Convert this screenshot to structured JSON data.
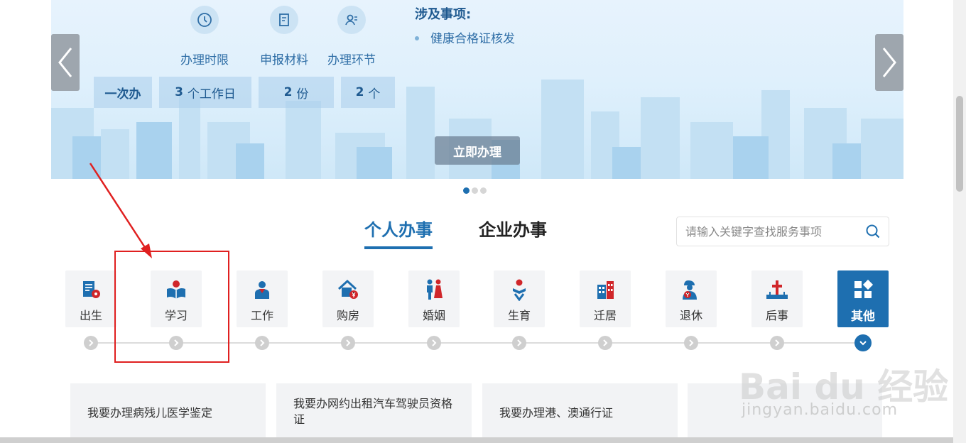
{
  "banner": {
    "info": [
      {
        "label": "办理时限",
        "icon": "clock-icon"
      },
      {
        "label": "申报材料",
        "icon": "document-icon"
      },
      {
        "label": "办理环节",
        "icon": "person-card-icon"
      }
    ],
    "values": [
      {
        "num": "",
        "text": "一次办"
      },
      {
        "num": "3",
        "text": "个工作日"
      },
      {
        "num": "2",
        "text": "份"
      },
      {
        "num": "2",
        "text": "个"
      }
    ],
    "matters_title": "涉及事项:",
    "matters_items": [
      "健康合格证核发"
    ],
    "go_button": "立即办理",
    "active_slide": 1,
    "slide_count": 3
  },
  "tabs": [
    {
      "label": "个人办事",
      "active": true
    },
    {
      "label": "企业办事",
      "active": false
    }
  ],
  "search": {
    "placeholder": "请输入关键字查找服务事项"
  },
  "categories": [
    {
      "label": "出生",
      "icon": "birth-certificate-icon"
    },
    {
      "label": "学习",
      "icon": "study-icon"
    },
    {
      "label": "工作",
      "icon": "work-icon"
    },
    {
      "label": "购房",
      "icon": "house-icon"
    },
    {
      "label": "婚姻",
      "icon": "marriage-icon"
    },
    {
      "label": "生育",
      "icon": "baby-icon"
    },
    {
      "label": "迁居",
      "icon": "building-icon"
    },
    {
      "label": "退休",
      "icon": "retire-icon"
    },
    {
      "label": "后事",
      "icon": "funeral-icon"
    },
    {
      "label": "其他",
      "icon": "grid-icon"
    }
  ],
  "cards": [
    {
      "text": "我要办理病残儿医学鉴定"
    },
    {
      "text": "我要办网约出租汽车驾驶员资格证"
    },
    {
      "text": "我要办理港、澳通行证"
    }
  ],
  "watermark": {
    "logo": "Bai du 经验",
    "url": "jingyan.baidu.com"
  },
  "colors": {
    "primary": "#1e6fb0",
    "highlight": "#e02020",
    "icon_red": "#d0262a"
  }
}
